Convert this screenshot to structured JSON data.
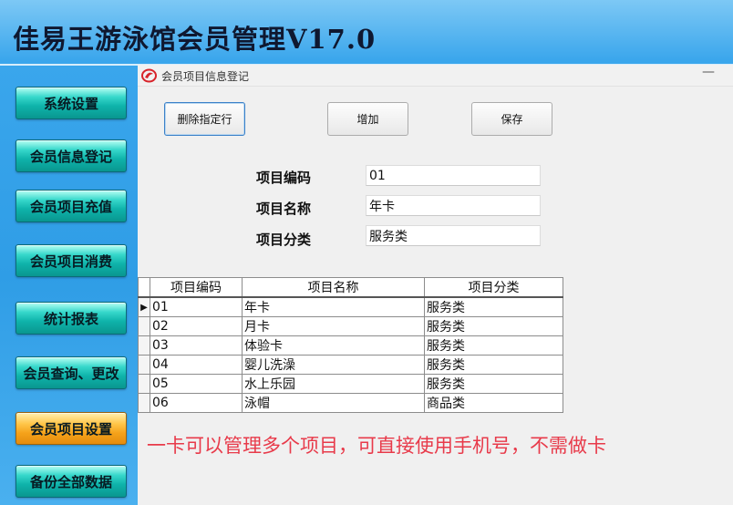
{
  "app": {
    "title": "佳易王游泳馆会员管理V17.0"
  },
  "sidebar": {
    "items": [
      {
        "label": "系统设置",
        "active": false
      },
      {
        "label": "会员信息登记",
        "active": false
      },
      {
        "label": "会员项目充值",
        "active": false
      },
      {
        "label": "会员项目消费",
        "active": false
      },
      {
        "label": "统计报表",
        "active": false
      },
      {
        "label": "会员查询、更改",
        "active": false
      },
      {
        "label": "会员项目设置",
        "active": true
      },
      {
        "label": "备份全部数据",
        "active": false
      }
    ]
  },
  "window": {
    "title": "会员项目信息登记",
    "minimize_label": "—",
    "logo_icon": "app-logo-icon"
  },
  "toolbar": {
    "delete_label": "删除指定行",
    "add_label": "增加",
    "save_label": "保存"
  },
  "form": {
    "code_label": "项目编码",
    "code_value": "01",
    "name_label": "项目名称",
    "name_value": "年卡",
    "category_label": "项目分类",
    "category_value": "服务类"
  },
  "grid": {
    "columns": [
      "项目编码",
      "项目名称",
      "项目分类"
    ],
    "current_row_marker": "▶",
    "rows": [
      {
        "code": "01",
        "name": "年卡",
        "category": "服务类"
      },
      {
        "code": "02",
        "name": "月卡",
        "category": "服务类"
      },
      {
        "code": "03",
        "name": "体验卡",
        "category": "服务类"
      },
      {
        "code": "04",
        "name": "婴儿洗澡",
        "category": "服务类"
      },
      {
        "code": "05",
        "name": "水上乐园",
        "category": "服务类"
      },
      {
        "code": "06",
        "name": "泳帽",
        "category": "商品类"
      }
    ]
  },
  "promo_text": "一卡可以管理多个项目，可直接使用手机号，不需做卡",
  "colors": {
    "promo": "#e83a4a",
    "sidebar_button": "#0fb3aa",
    "sidebar_active": "#f5a21a",
    "background": "#3aa0e6"
  }
}
